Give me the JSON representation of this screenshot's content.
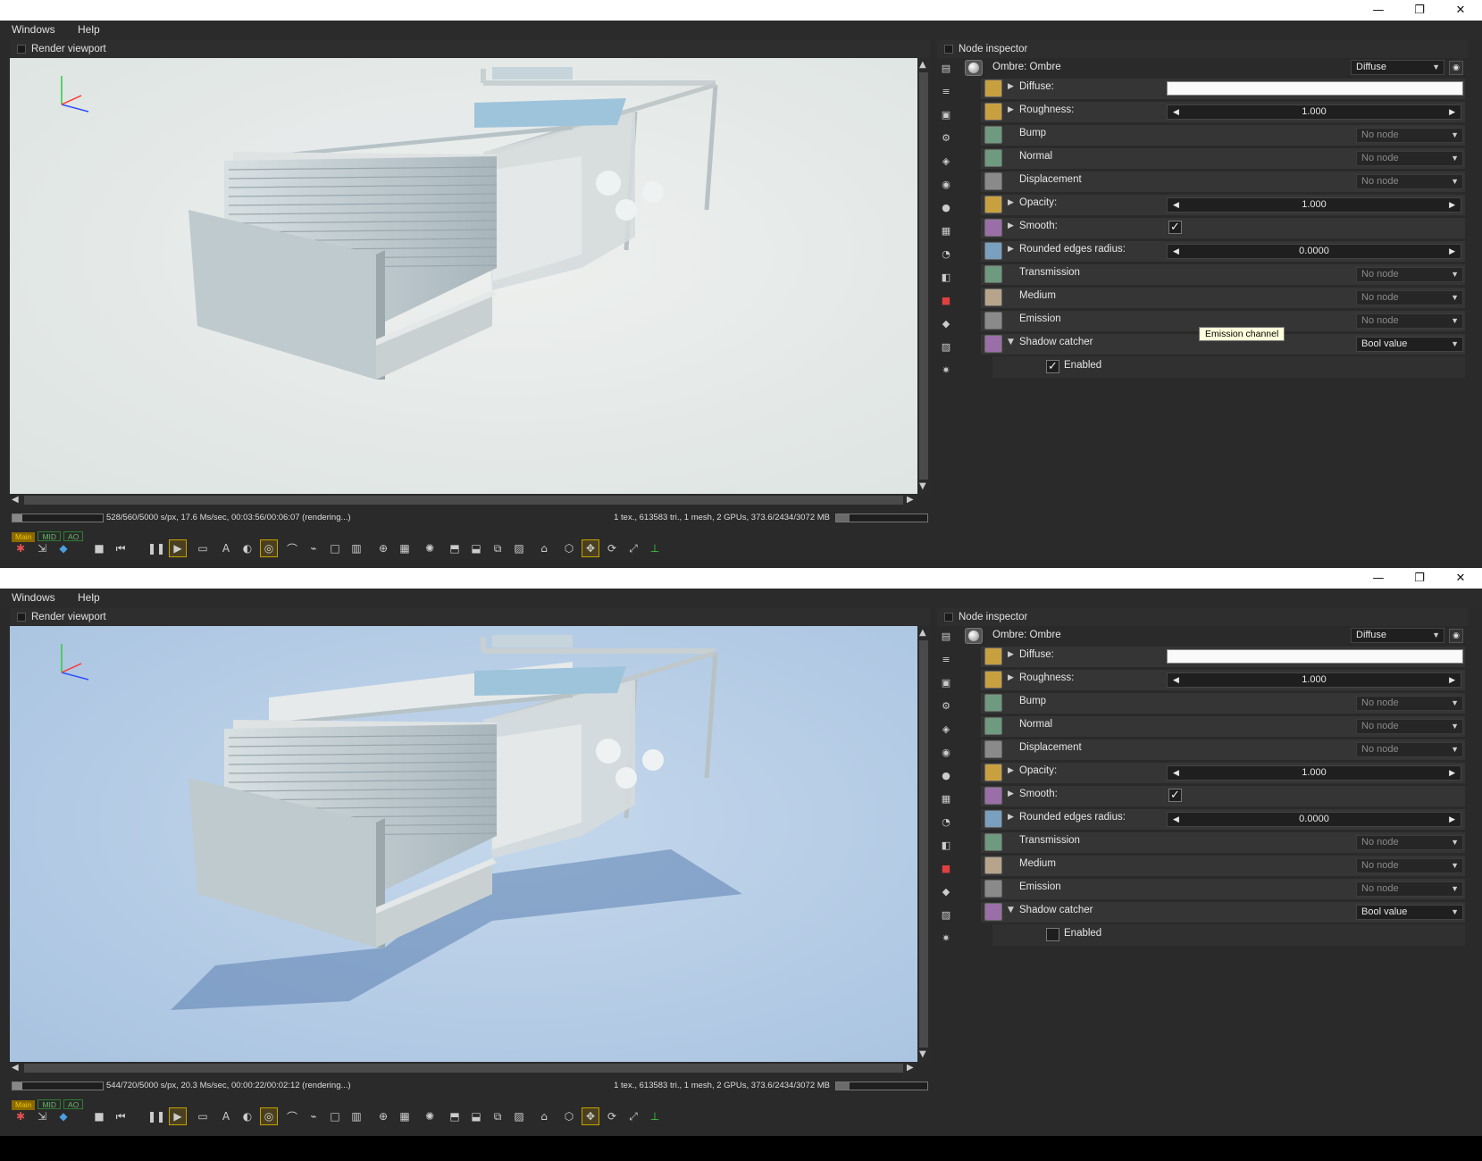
{
  "windows_data": [
    {
      "menu": [
        "Windows",
        "Help"
      ],
      "title_buttons": {
        "minimize": "—",
        "restore": "❐",
        "close": "✕"
      },
      "viewport_title": "Render viewport",
      "inspector_title": "Node inspector",
      "status_left": "528/560/5000 s/px, 17.6 Ms/sec, 00:03:56/00:06:07 (rendering...)",
      "status_right": "1 tex., 613583 tri., 1 mesh, 2 GPUs, 373.6/2434/3072 MB",
      "render_progress": 0.11,
      "gpu_memory": 0.15,
      "tags": [
        "Main",
        "MID",
        "AO"
      ],
      "node_title": "Ombre: Ombre",
      "node_type": "Diffuse",
      "pins": [
        {
          "label": "Diffuse:",
          "kind": "color"
        },
        {
          "label": "Roughness:",
          "kind": "slider",
          "value": "1.000"
        },
        {
          "label": "Bump",
          "kind": "node",
          "value": "No node"
        },
        {
          "label": "Normal",
          "kind": "node",
          "value": "No node"
        },
        {
          "label": "Displacement",
          "kind": "node",
          "value": "No node"
        },
        {
          "label": "Opacity:",
          "kind": "slider",
          "value": "1.000"
        },
        {
          "label": "Smooth:",
          "kind": "check",
          "checked": true
        },
        {
          "label": "Rounded edges radius:",
          "kind": "slider",
          "value": "0.0000"
        },
        {
          "label": "Transmission",
          "kind": "node",
          "value": "No node"
        },
        {
          "label": "Medium",
          "kind": "node",
          "value": "No node"
        },
        {
          "label": "Emission",
          "kind": "node",
          "value": "No node"
        },
        {
          "label": "Shadow catcher",
          "kind": "bool",
          "value": "Bool value"
        }
      ],
      "enabled_label": "Enabled",
      "enabled_checked": true,
      "tooltip": "Emission channel",
      "sky": "#dde4e2"
    },
    {
      "menu": [
        "Windows",
        "Help"
      ],
      "title_buttons": {
        "minimize": "—",
        "restore": "❐",
        "close": "✕"
      },
      "viewport_title": "Render viewport",
      "inspector_title": "Node inspector",
      "status_left": "544/720/5000 s/px, 20.3 Ms/sec, 00:00:22/00:02:12 (rendering...)",
      "status_right": "1 tex., 613583 tri., 1 mesh, 2 GPUs, 373.6/2434/3072 MB",
      "render_progress": 0.11,
      "gpu_memory": 0.15,
      "tags": [
        "Main",
        "MID",
        "AO"
      ],
      "node_title": "Ombre: Ombre",
      "node_type": "Diffuse",
      "pins": [
        {
          "label": "Diffuse:",
          "kind": "color"
        },
        {
          "label": "Roughness:",
          "kind": "slider",
          "value": "1.000"
        },
        {
          "label": "Bump",
          "kind": "node",
          "value": "No node"
        },
        {
          "label": "Normal",
          "kind": "node",
          "value": "No node"
        },
        {
          "label": "Displacement",
          "kind": "node",
          "value": "No node"
        },
        {
          "label": "Opacity:",
          "kind": "slider",
          "value": "1.000"
        },
        {
          "label": "Smooth:",
          "kind": "check",
          "checked": true
        },
        {
          "label": "Rounded edges radius:",
          "kind": "slider",
          "value": "0.0000"
        },
        {
          "label": "Transmission",
          "kind": "node",
          "value": "No node"
        },
        {
          "label": "Medium",
          "kind": "node",
          "value": "No node"
        },
        {
          "label": "Emission",
          "kind": "node",
          "value": "No node"
        },
        {
          "label": "Shadow catcher",
          "kind": "bool",
          "value": "Bool value"
        }
      ],
      "enabled_label": "Enabled",
      "enabled_checked": false,
      "tooltip": "",
      "sky": "#a9c3e0"
    }
  ],
  "pin_icon_colors": {
    "color": "#c9a040",
    "slider": "#7aa0c0",
    "node_green": "#6e9a80",
    "node_gray": "#8a8a8a",
    "node_tan": "#b6a58a",
    "bool": "#9a6fa8"
  },
  "toolbar_icons": [
    "reset-icon",
    "lock-icon",
    "cube-icon",
    "stop-icon",
    "rewind-icon",
    "pause-icon",
    "play-icon",
    "screen-icon",
    "af-icon",
    "color-icon",
    "focus-icon",
    "material-icon",
    "light-icon",
    "region-icon",
    "film-icon",
    "zoom-icon",
    "render-region-icon",
    "sun-icon",
    "export-icon",
    "import-icon",
    "copy-icon",
    "tonemap-icon",
    "unlock-icon",
    "box-icon",
    "move-icon",
    "rotate-icon",
    "fit-icon",
    "axes-icon"
  ]
}
